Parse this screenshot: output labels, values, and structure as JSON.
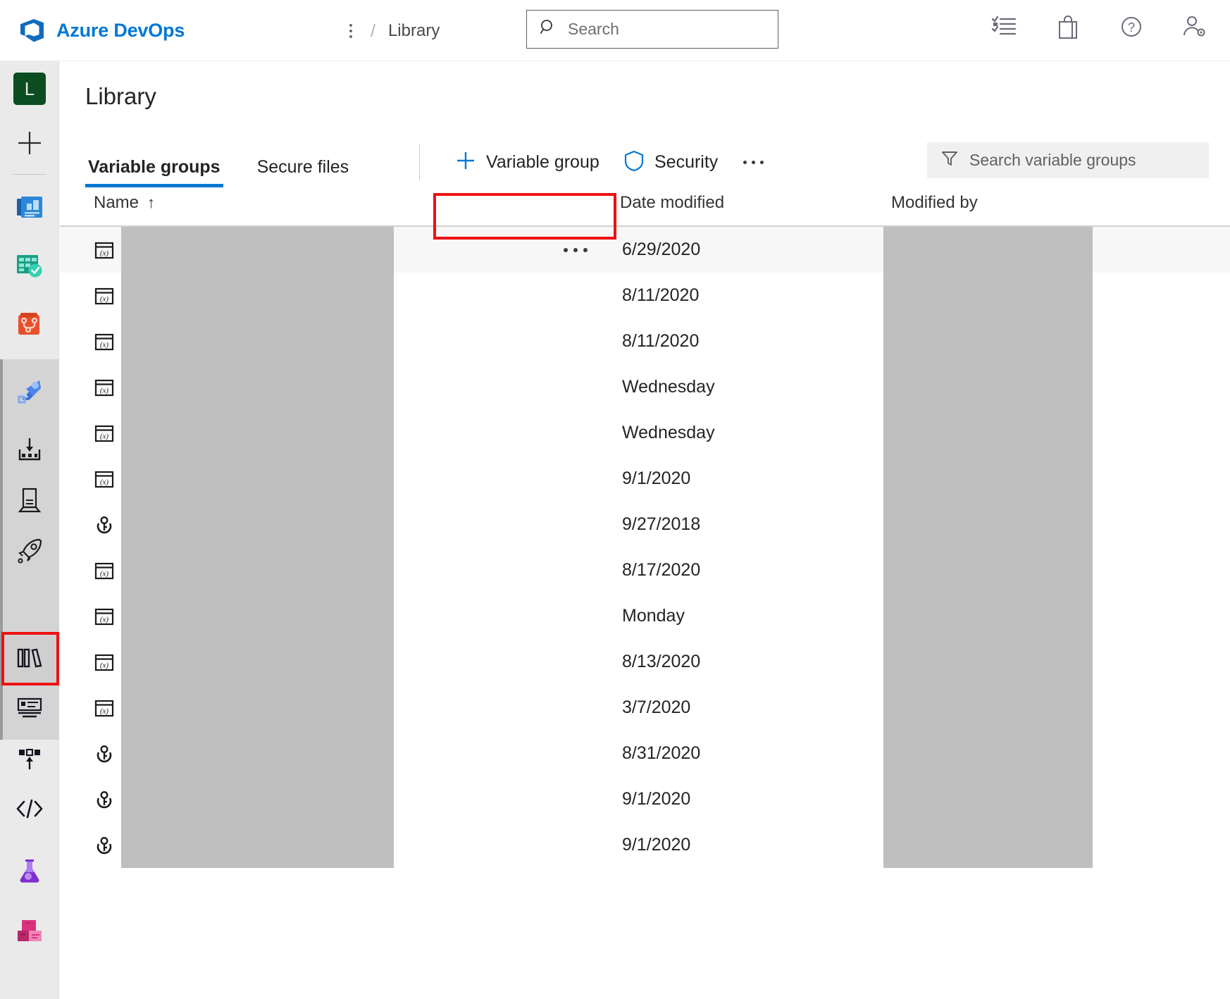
{
  "topbar": {
    "logo_icon": "azure-devops-logo-icon",
    "brand": "Azure DevOps",
    "breadcrumb": {
      "more_icon": "vertical-ellipsis-icon",
      "separator": "/",
      "current": "Library"
    },
    "search": {
      "icon": "search-icon",
      "placeholder": "Search",
      "value": ""
    },
    "icons": [
      {
        "name": "boards-checklist-icon",
        "title": "Work items"
      },
      {
        "name": "marketplace-bag-icon",
        "title": "Marketplace"
      },
      {
        "name": "help-question-icon",
        "title": "Help"
      },
      {
        "name": "user-settings-icon",
        "title": "User settings"
      }
    ]
  },
  "rail": {
    "project_avatar_letter": "L",
    "items": [
      {
        "name": "project-avatar",
        "icon": "project-avatar-L",
        "label": "L"
      },
      {
        "name": "new-item",
        "icon": "plus-icon",
        "label": "New"
      },
      {
        "name": "overview",
        "icon": "overview-dashboard-icon",
        "label": "Overview"
      },
      {
        "name": "boards",
        "icon": "boards-grid-check-icon",
        "label": "Boards"
      },
      {
        "name": "repos",
        "icon": "repos-branch-icon",
        "label": "Repos"
      },
      {
        "name": "pipelines",
        "icon": "pipelines-rocket-blue-icon",
        "label": "Pipelines"
      },
      {
        "name": "releases",
        "icon": "releases-download-icon",
        "label": "Releases"
      },
      {
        "name": "environments",
        "icon": "environments-server-icon",
        "label": "Environments"
      },
      {
        "name": "deployment-groups",
        "icon": "deployment-rocket-icon",
        "label": "Deployment groups"
      },
      {
        "name": "library",
        "icon": "library-books-icon",
        "label": "Library"
      },
      {
        "name": "task-groups",
        "icon": "task-groups-card-icon",
        "label": "Task groups"
      },
      {
        "name": "deployment-pools",
        "icon": "deployment-pools-upload-icon",
        "label": "Deployment pools"
      },
      {
        "name": "xaml-definitions",
        "icon": "code-brackets-icon",
        "label": "XAML definitions"
      },
      {
        "name": "test-plans",
        "icon": "test-plans-flask-icon",
        "label": "Test Plans"
      },
      {
        "name": "artifacts",
        "icon": "artifacts-boxes-icon",
        "label": "Artifacts"
      }
    ],
    "selected": "library",
    "highlight_color": "#ee1111"
  },
  "page": {
    "title": "Library"
  },
  "toolbar": {
    "tabs": [
      {
        "label": "Variable groups",
        "active": true
      },
      {
        "label": "Secure files",
        "active": false
      }
    ],
    "commands": [
      {
        "name": "new-variable-group-button",
        "label": "Variable group",
        "icon": "plus-icon",
        "highlighted": true
      },
      {
        "name": "security-button",
        "label": "Security",
        "icon": "shield-icon",
        "highlighted": false
      },
      {
        "name": "more-commands-button",
        "label": "...",
        "icon": "ellipsis-icon",
        "highlighted": false
      }
    ],
    "filter": {
      "icon": "filter-funnel-icon",
      "placeholder": "Search variable groups",
      "value": ""
    },
    "highlight_color": "#ee1111",
    "accent_color": "#0078d4"
  },
  "table": {
    "columns": [
      {
        "key": "name",
        "label": "Name",
        "sort": "↑"
      },
      {
        "key": "date_modified",
        "label": "Date modified"
      },
      {
        "key": "modified_by",
        "label": "Modified by"
      }
    ],
    "rows": [
      {
        "icon": "variable-group-icon",
        "name": "",
        "name_redacted": true,
        "date_modified": "6/29/2020",
        "modified_by": "",
        "modified_by_redacted": true,
        "hovered": true,
        "show_row_menu": true
      },
      {
        "icon": "variable-group-icon",
        "name": "",
        "name_redacted": true,
        "date_modified": "8/11/2020",
        "modified_by": "",
        "modified_by_redacted": true,
        "hovered": false,
        "show_row_menu": false
      },
      {
        "icon": "variable-group-icon",
        "name": "",
        "name_redacted": true,
        "date_modified": "8/11/2020",
        "modified_by": "",
        "modified_by_redacted": true,
        "hovered": false,
        "show_row_menu": false
      },
      {
        "icon": "variable-group-icon",
        "name": "",
        "name_redacted": true,
        "date_modified": "Wednesday",
        "modified_by": "",
        "modified_by_redacted": true,
        "hovered": false,
        "show_row_menu": false
      },
      {
        "icon": "variable-group-icon",
        "name": "",
        "name_redacted": true,
        "date_modified": "Wednesday",
        "modified_by": "",
        "modified_by_redacted": true,
        "hovered": false,
        "show_row_menu": false
      },
      {
        "icon": "variable-group-icon",
        "name": "",
        "name_redacted": true,
        "date_modified": "9/1/2020",
        "modified_by": "",
        "modified_by_redacted": true,
        "hovered": false,
        "show_row_menu": false
      },
      {
        "icon": "linked-key-icon",
        "name": "",
        "name_redacted": true,
        "date_modified": "9/27/2018",
        "modified_by": "",
        "modified_by_redacted": true,
        "hovered": false,
        "show_row_menu": false
      },
      {
        "icon": "variable-group-icon",
        "name": "",
        "name_redacted": true,
        "date_modified": "8/17/2020",
        "modified_by": "",
        "modified_by_redacted": true,
        "hovered": false,
        "show_row_menu": false
      },
      {
        "icon": "variable-group-icon",
        "name": "",
        "name_redacted": true,
        "date_modified": "Monday",
        "modified_by": "",
        "modified_by_redacted": true,
        "hovered": false,
        "show_row_menu": false
      },
      {
        "icon": "variable-group-icon",
        "name": "",
        "name_redacted": true,
        "date_modified": "8/13/2020",
        "modified_by": "",
        "modified_by_redacted": true,
        "hovered": false,
        "show_row_menu": false
      },
      {
        "icon": "variable-group-icon",
        "name": "",
        "name_redacted": true,
        "date_modified": "3/7/2020",
        "modified_by": "",
        "modified_by_redacted": true,
        "hovered": false,
        "show_row_menu": false
      },
      {
        "icon": "linked-key-icon",
        "name": "",
        "name_redacted": true,
        "date_modified": "8/31/2020",
        "modified_by": "",
        "modified_by_redacted": true,
        "hovered": false,
        "show_row_menu": false
      },
      {
        "icon": "linked-key-icon",
        "name": "",
        "name_redacted": true,
        "date_modified": "9/1/2020",
        "modified_by": "",
        "modified_by_redacted": true,
        "hovered": false,
        "show_row_menu": false
      },
      {
        "icon": "linked-key-icon",
        "name": "",
        "name_redacted": true,
        "date_modified": "9/1/2020",
        "modified_by": "",
        "modified_by_redacted": true,
        "hovered": false,
        "show_row_menu": false
      }
    ]
  }
}
